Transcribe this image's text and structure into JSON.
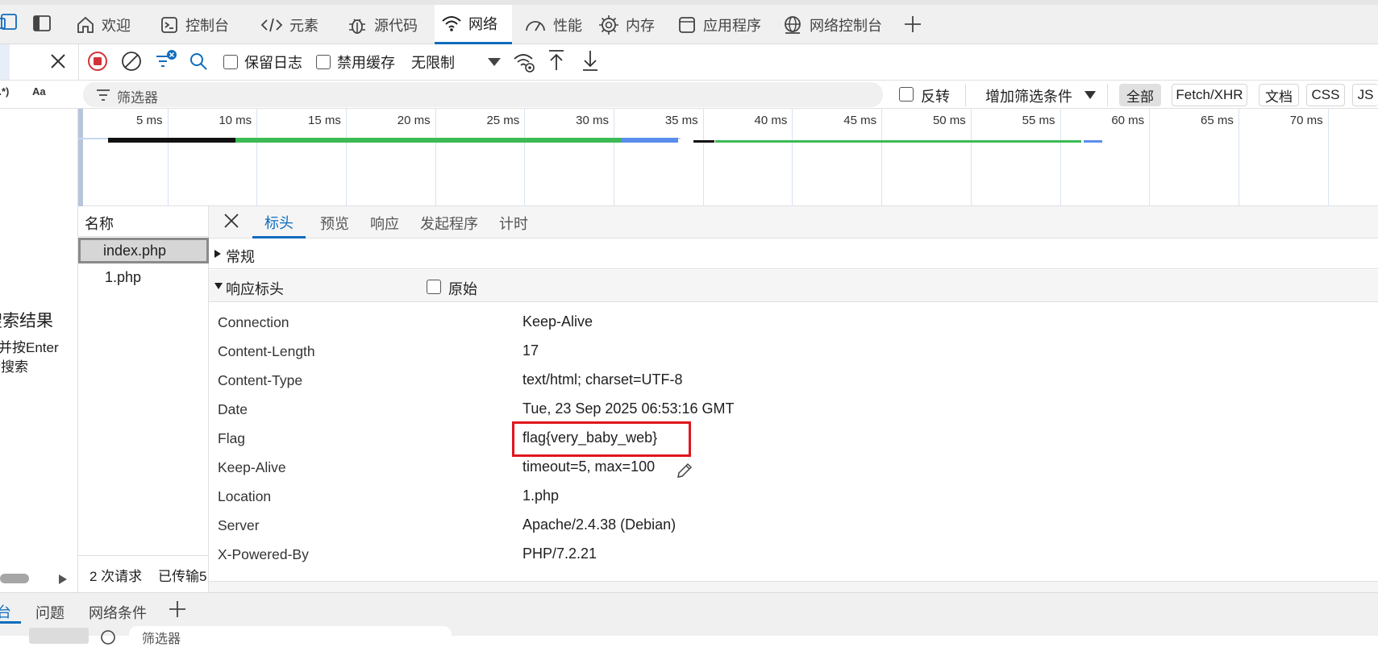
{
  "tabs": [
    {
      "label": "欢迎",
      "icon": "home-icon"
    },
    {
      "label": "控制台",
      "icon": "console-icon"
    },
    {
      "label": "元素",
      "icon": "code-icon"
    },
    {
      "label": "源代码",
      "icon": "bug-icon"
    },
    {
      "label": "网络",
      "icon": "wifi-icon",
      "active": true
    },
    {
      "label": "性能",
      "icon": "gauge-icon"
    },
    {
      "label": "内存",
      "icon": "chip-icon"
    },
    {
      "label": "应用程序",
      "icon": "app-icon"
    },
    {
      "label": "网络控制台",
      "icon": "globe-icon"
    }
  ],
  "toolbar": {
    "preserve_log": "保留日志",
    "disable_cache": "禁用缓存",
    "throttling": "无限制"
  },
  "left": {
    "regex_label": "(.*)",
    "case_label": "Aa",
    "search_title": "搜索结果",
    "search_hint_1": "并按Enter",
    "search_hint_2": "行搜索"
  },
  "filter": {
    "placeholder": "筛选器",
    "invert": "反转",
    "more_filters": "增加筛选条件",
    "types": [
      "全部",
      "Fetch/XHR",
      "文档",
      "CSS",
      "JS"
    ]
  },
  "timeline": {
    "ticks": [
      "5 ms",
      "10 ms",
      "15 ms",
      "20 ms",
      "25 ms",
      "30 ms",
      "35 ms",
      "40 ms",
      "45 ms",
      "50 ms",
      "55 ms",
      "60 ms",
      "65 ms",
      "70 ms"
    ]
  },
  "requests": {
    "header": "名称",
    "items": [
      "index.php",
      "1.php"
    ],
    "status_requests": "2 次请求",
    "status_transferred": "已传输5"
  },
  "details": {
    "tabs": [
      "标头",
      "预览",
      "响应",
      "发起程序",
      "计时"
    ],
    "general": "常规",
    "response_headers": "响应标头",
    "raw": "原始",
    "headers": [
      {
        "name": "Connection",
        "value": "Keep-Alive"
      },
      {
        "name": "Content-Length",
        "value": "17"
      },
      {
        "name": "Content-Type",
        "value": "text/html; charset=UTF-8"
      },
      {
        "name": "Date",
        "value": "Tue, 23 Sep 2025 06:53:16 GMT"
      },
      {
        "name": "Flag",
        "value": "flag{very_baby_web}"
      },
      {
        "name": "Keep-Alive",
        "value": "timeout=5, max=100"
      },
      {
        "name": "Location",
        "value": "1.php"
      },
      {
        "name": "Server",
        "value": "Apache/2.4.38 (Debian)"
      },
      {
        "name": "X-Powered-By",
        "value": "PHP/7.2.21"
      }
    ]
  },
  "drawer": {
    "tabs": [
      "台",
      "问题",
      "网络条件"
    ],
    "filter_placeholder": "筛选器"
  },
  "colors": {
    "accent": "#0f6cbd",
    "record": "#d13438",
    "highlight_box": "#e0161e",
    "bar_green": "#3cba54",
    "bar_blue": "#5b8def",
    "bar_black": "#111111"
  }
}
